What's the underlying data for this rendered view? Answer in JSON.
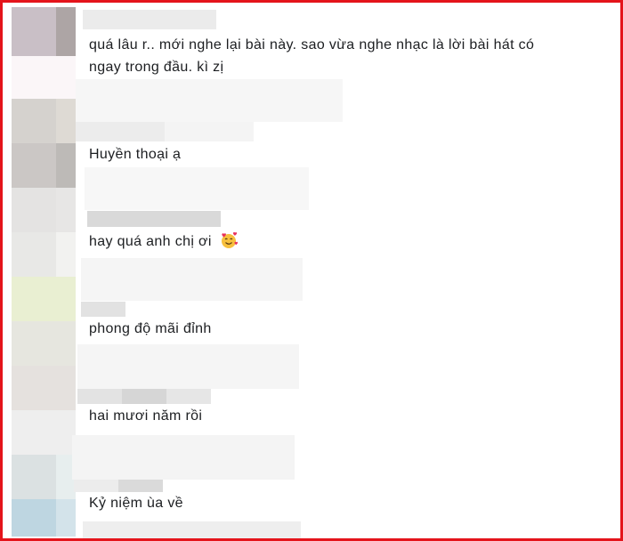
{
  "comments": [
    {
      "line1": "quá lâu r.. mới nghe lại bài này. sao vừa nghe nhạc là lời bài hát có",
      "line2": "ngay trong đầu. kì zị"
    },
    {
      "text": "Huyền thoại ạ"
    },
    {
      "text": "hay quá anh chị ơi",
      "emoji": "smiling-face-with-hearts-icon"
    },
    {
      "text": "phong độ mãi đỉnh"
    },
    {
      "text": "hai mươi năm rồi"
    },
    {
      "text": "Kỷ niệm ùa về"
    }
  ],
  "colors": {
    "frame": "#e4141b",
    "text": "#1c1e21"
  }
}
